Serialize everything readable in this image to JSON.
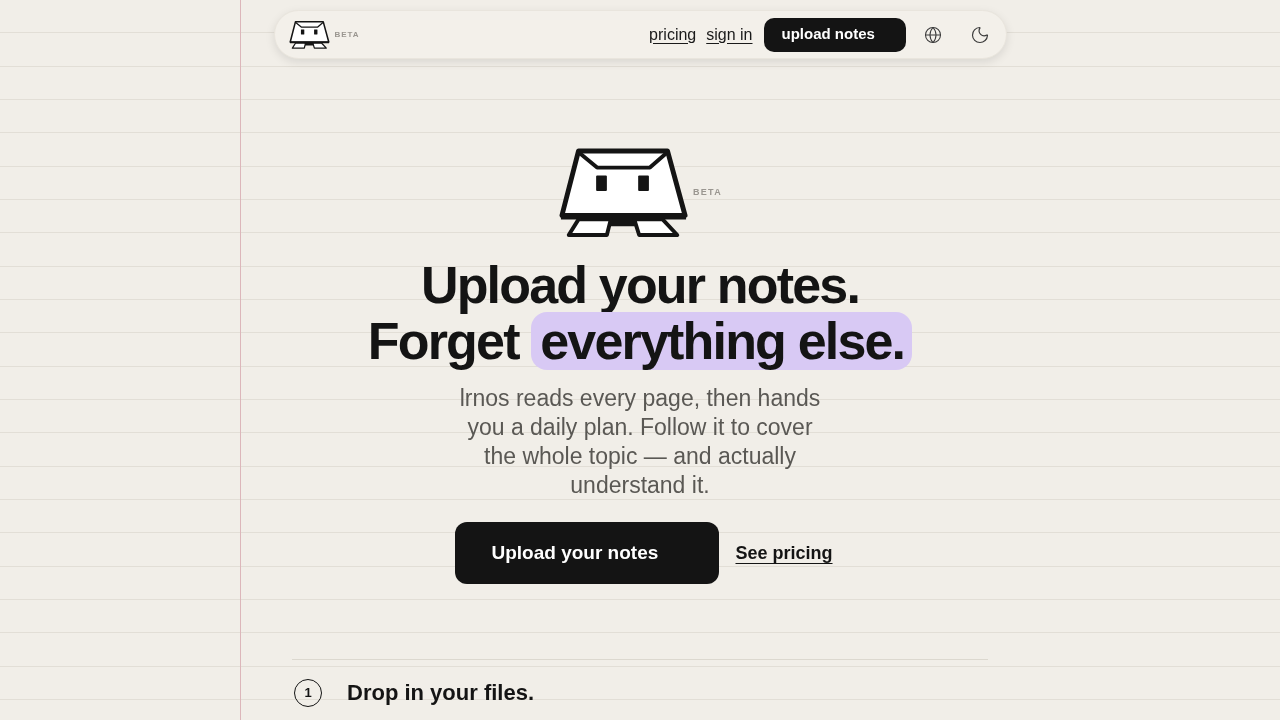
{
  "nav": {
    "beta_label": "BETA",
    "links": [
      {
        "label": "pricing"
      },
      {
        "label": "sign in"
      }
    ],
    "cta_button": "upload notes"
  },
  "hero": {
    "beta_label": "BETA",
    "headline": {
      "line_1": "Upload your notes.",
      "line_2": "Forget",
      "line_2_highlight": "everything else."
    },
    "description": "lrnos reads every page, then hands you a daily plan. Follow it to cover the whole topic — and actually understand it.",
    "primary_button": "Upload your notes",
    "secondary_link": "See pricing"
  },
  "steps": [
    {
      "number": "1",
      "title": "Drop in your files."
    }
  ]
}
